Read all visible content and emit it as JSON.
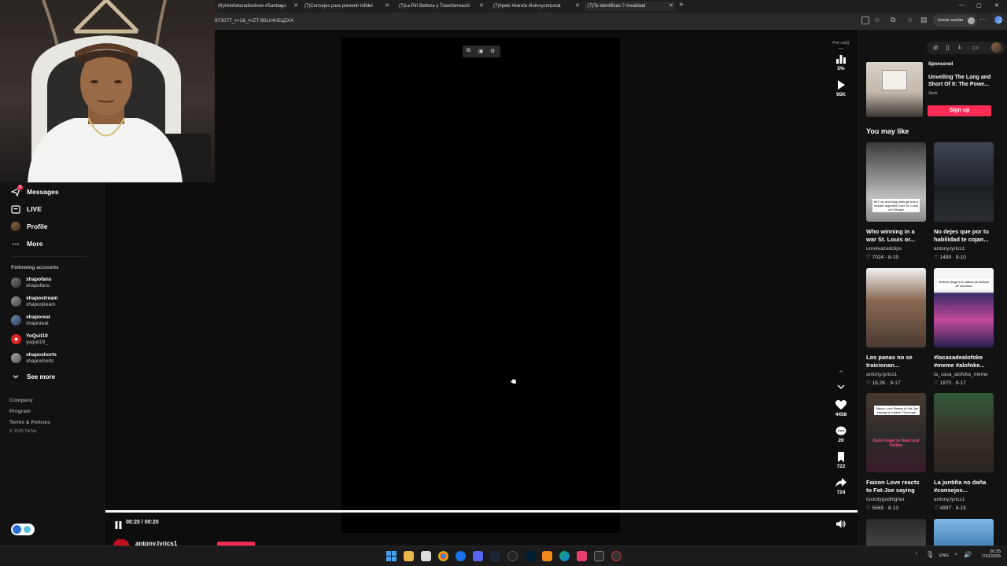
{
  "browser": {
    "tabs": [
      {
        "label": "(6)#Alofokeradioshow #Santiago"
      },
      {
        "label": "(7)Consejos para prevenir infidel"
      },
      {
        "label": "(7)La Piri Belleza y Transformació"
      },
      {
        "label": "(7)#peki #karola #luinnycorporat"
      },
      {
        "label": "(7)Te identificas ? #realidad"
      }
    ],
    "url": "873077_r=1&_t=ZT-90Lh4nEqZXA",
    "signin_label": "Iniciar sesión",
    "window_controls": [
      "—",
      "▢",
      "✕"
    ]
  },
  "sidebar": {
    "nav": [
      {
        "label": "Messages",
        "icon": "paper-plane-icon",
        "badge": "1"
      },
      {
        "label": "LIVE",
        "icon": "live-tv-icon"
      },
      {
        "label": "Profile",
        "icon": "profile-avatar-icon"
      },
      {
        "label": "More",
        "icon": "ellipsis-icon"
      }
    ],
    "following_title": "Following accounts",
    "accounts": [
      {
        "name": "xhapofans",
        "handle": "xhapofans"
      },
      {
        "name": "xhapostream",
        "handle": "xhapostream"
      },
      {
        "name": "xhaporeal",
        "handle": "xhaporeal"
      },
      {
        "name": "YoQuil19",
        "handle": "yoquil19_"
      },
      {
        "name": "xhaposhorts",
        "handle": "xhaposhorts"
      }
    ],
    "see_more": "See more",
    "footer": [
      "Company",
      "Program",
      "Terms & Policies",
      "© 2025 TikTok"
    ]
  },
  "player": {
    "quality_label": "Por calQ",
    "percent": "5%",
    "plays": "95K",
    "likes": "4458",
    "comments": "20",
    "saves": "722",
    "shares": "724",
    "time": "00:20 / 00:20",
    "progress": 1.0,
    "author": "antony.lyrics1"
  },
  "sponsored": {
    "tag": "Sponsored",
    "title": "Unveiling The Long and Short Of It: The Powe...",
    "brand": "Xero",
    "cta": "Sign up"
  },
  "you_may_like": {
    "heading": "You may like",
    "cards": [
      {
        "title": "Who winning in a war St. Louis or...",
        "author": "unreleazedclips",
        "likes": "7024",
        "date": "8-19",
        "overlay": "607.rec and king yella get into a heated argument over St. Louis vs Chicago"
      },
      {
        "title": "No dejes que por tu habilidad te cojan...",
        "author": "antony.lyrics1",
        "likes": "1499",
        "date": "8-10",
        "overlay": ""
      },
      {
        "title": "Los panas no se traicionan...",
        "author": "antony.lyrics1",
        "likes": "15.2K",
        "date": "9-17",
        "overlay": ""
      },
      {
        "title": "#lacasadealofoke #meme #alofoke...",
        "author": "la_casa_alofoka_meme",
        "likes": "1870",
        "date": "9-17",
        "overlay": "Jimenez llega a la cabina de Alofoke de sorpresa"
      },
      {
        "title": "Faizon Love reacts to Fat-Joe saying he...",
        "author": "toxicitygodhigher",
        "likes": "5565",
        "date": "8-13",
        "overlay": "Faizon Love Reacts to Fat-Joe saying he robbed 70 people."
      },
      {
        "title": "La juntiña no daña #consejos...",
        "author": "antony.lyrics1",
        "likes": "4997",
        "date": "8-15",
        "overlay": ""
      }
    ],
    "follow_overlay": "Dont Forget to Heart and Follow"
  },
  "taskbar": {
    "lang": "ENG",
    "time": "20:35",
    "date": "7/10/2025"
  }
}
